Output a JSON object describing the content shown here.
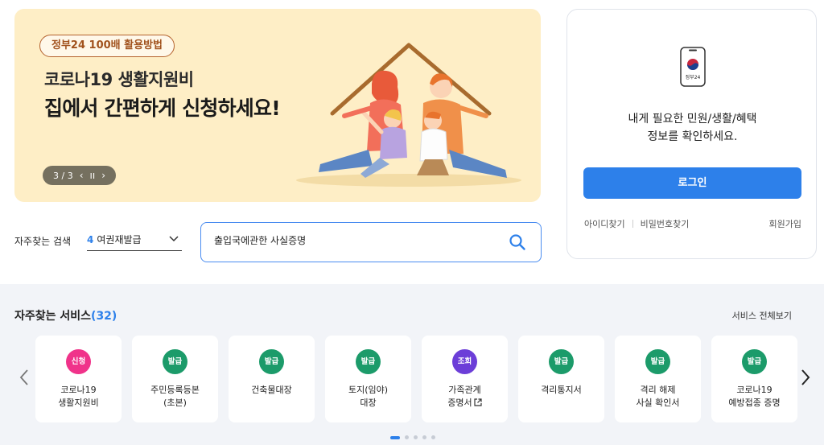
{
  "banner": {
    "tag": "정부24 100배 활용방법",
    "title_line1": "코로나19 생활지원비",
    "title_line2": "집에서 간편하게 신청하세요!",
    "pager": "3 / 3",
    "prev_icon": "chevron-left-icon",
    "pause_icon": "pause-icon",
    "next_icon": "chevron-right-icon"
  },
  "login": {
    "app_icon_label": "정부24",
    "desc_line1": "내게 필요한 민원/생활/혜택",
    "desc_line2": "정보를 확인하세요.",
    "login_button": "로그인",
    "find_id": "아이디찾기",
    "find_password": "비밀번호찾기",
    "signup": "회원가입",
    "accent_color": "#2d80ea"
  },
  "search": {
    "label": "자주찾는 검색",
    "select_number": "4",
    "select_value": "여권재발급",
    "input_value": "출입국에관한 사실증명"
  },
  "services": {
    "title": "자주찾는 서비스",
    "count": "(32)",
    "view_all": "서비스 전체보기",
    "items": [
      {
        "badge": "신청",
        "badge_color": "#f0338a",
        "label": "코로나19\n생활지원비"
      },
      {
        "badge": "발급",
        "badge_color": "#1c9b6a",
        "label": "주민등록등본\n(초본)"
      },
      {
        "badge": "발급",
        "badge_color": "#1c9b6a",
        "label": "건축물대장"
      },
      {
        "badge": "발급",
        "badge_color": "#1c9b6a",
        "label": "토지(임야)\n대장"
      },
      {
        "badge": "조회",
        "badge_color": "#6c3ed8",
        "label": "가족관계\n증명서"
      },
      {
        "badge": "발급",
        "badge_color": "#1c9b6a",
        "label": "격리통지서"
      },
      {
        "badge": "발급",
        "badge_color": "#1c9b6a",
        "label": "격리 해제\n사실 확인서"
      },
      {
        "badge": "발급",
        "badge_color": "#1c9b6a",
        "label": "코로나19\n예방접종 증명"
      }
    ]
  }
}
